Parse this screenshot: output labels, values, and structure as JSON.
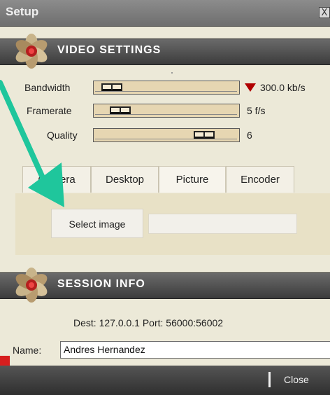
{
  "window": {
    "title": "Setup",
    "close_glyph": "X"
  },
  "video_settings": {
    "header": "VIDEO SETTINGS",
    "rows": [
      {
        "label": "Bandwidth",
        "value": "300.0 kb/s",
        "level": 0.05,
        "indicator": "down-triangle-red"
      },
      {
        "label": "Framerate",
        "value": "5 f/s",
        "level": 0.12
      },
      {
        "label": "Quality",
        "value": "6",
        "level": 0.8
      }
    ]
  },
  "tabs": [
    {
      "label": "Camera",
      "active": false
    },
    {
      "label": "Desktop",
      "active": false
    },
    {
      "label": "Picture",
      "active": true
    },
    {
      "label": "Encoder",
      "active": false
    }
  ],
  "picture_tab": {
    "select_button": "Select image",
    "image_path": ""
  },
  "session_info": {
    "header": "SESSION INFO",
    "dest": "Dest: 127.0.0.1  Port: 56000:56002",
    "name_label": "Name:",
    "name_value": "Andres Hernandez"
  },
  "footer": {
    "close_label": "Close"
  },
  "colors": {
    "accent_arrow": "#1fc69c",
    "bandwidth_indicator": "#b00000",
    "footer_red": "#d61e1e"
  }
}
